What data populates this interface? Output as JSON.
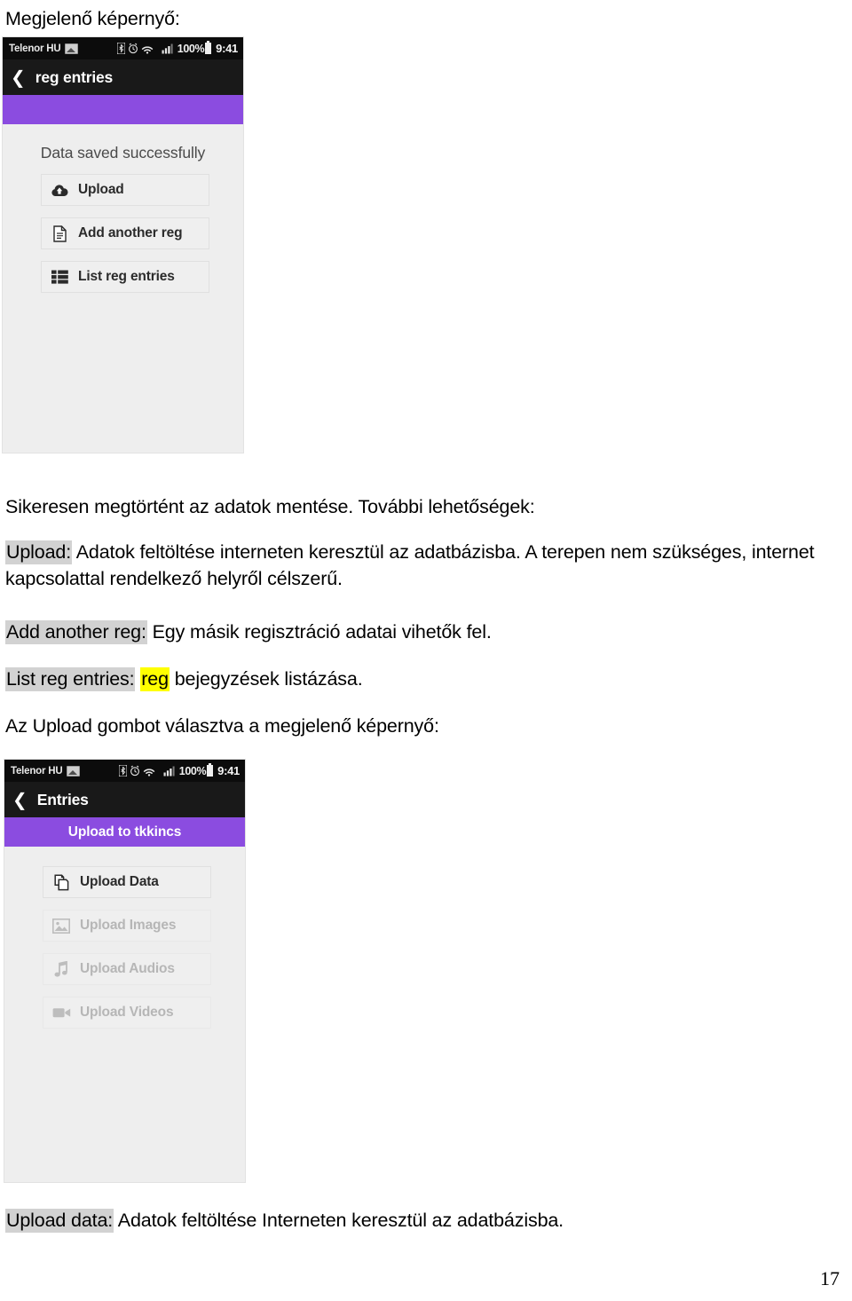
{
  "document": {
    "heading": "Megjelenő képernyő:",
    "paragraphs": [
      {
        "id": "p-success",
        "segments": [
          {
            "text": "Sikeresen megtörtént az adatok mentése. További lehetőségek:",
            "highlight": "none"
          }
        ]
      },
      {
        "id": "p-upload",
        "segments": [
          {
            "text": "Upload:",
            "highlight": "gray"
          },
          {
            "text": " Adatok feltöltése interneten keresztül az adatbázisba. A terepen nem szükséges, internet kapcsolattal rendelkező helyről célszerű.",
            "highlight": "none"
          }
        ]
      },
      {
        "id": "p-add-another",
        "segments": [
          {
            "text": "Add another reg:",
            "highlight": "gray"
          },
          {
            "text": " Egy másik regisztráció adatai vihetők fel.",
            "highlight": "none"
          }
        ]
      },
      {
        "id": "p-list-entries",
        "segments": [
          {
            "text": "List reg entries:",
            "highlight": "gray"
          },
          {
            "text": " ",
            "highlight": "none"
          },
          {
            "text": "reg",
            "highlight": "yellow"
          },
          {
            "text": " bejegyzések listázása.",
            "highlight": "none"
          }
        ]
      },
      {
        "id": "p-upload-intro",
        "segments": [
          {
            "text": "Az Upload gombot választva a megjelenő képernyő:",
            "highlight": "none"
          }
        ]
      },
      {
        "id": "p-upload-data",
        "segments": [
          {
            "text": "Upload data:",
            "highlight": "gray"
          },
          {
            "text": " Adatok feltöltése Interneten keresztül az adatbázisba.",
            "highlight": "none"
          }
        ]
      }
    ],
    "page_number": "17"
  },
  "colors": {
    "accent_purple": "#8b4ce0",
    "statusbar_black": "#0c0c0c",
    "titlebar_black": "#191919",
    "screen_gray": "#eeeeee",
    "highlight_gray": "#d2d2d2",
    "highlight_yellow": "#ffff00",
    "disabled_text": "#b6b6b6"
  },
  "screenshot_one": {
    "statusbar": {
      "carrier": "Telenor HU",
      "icons": [
        "photo-icon",
        "bluetooth-icon",
        "alarm-clock-icon",
        "wifi-icon",
        "signal-bars-icon"
      ],
      "battery_percent": "100%",
      "time": "9:41"
    },
    "titlebar": {
      "back_icon": "back-chevron-icon",
      "title": "reg entries"
    },
    "banner": {
      "text": ""
    },
    "status_message": "Data saved successfully",
    "buttons": [
      {
        "label": "Upload",
        "icon": "cloud-upload-icon",
        "disabled": false
      },
      {
        "label": "Add another reg",
        "icon": "document-icon",
        "disabled": false
      },
      {
        "label": "List reg entries",
        "icon": "list-grid-icon",
        "disabled": false
      }
    ]
  },
  "screenshot_two": {
    "statusbar": {
      "carrier": "Telenor HU",
      "icons": [
        "photo-icon",
        "bluetooth-icon",
        "alarm-clock-icon",
        "wifi-icon",
        "signal-bars-icon"
      ],
      "battery_percent": "100%",
      "time": "9:41"
    },
    "titlebar": {
      "back_icon": "back-chevron-icon",
      "title": "Entries"
    },
    "banner": {
      "text": "Upload to tkkincs"
    },
    "buttons": [
      {
        "label": "Upload Data",
        "icon": "copy-files-icon",
        "disabled": false
      },
      {
        "label": "Upload Images",
        "icon": "image-icon",
        "disabled": true
      },
      {
        "label": "Upload Audios",
        "icon": "music-note-icon",
        "disabled": true
      },
      {
        "label": "Upload Videos",
        "icon": "video-camera-icon",
        "disabled": true
      }
    ]
  }
}
